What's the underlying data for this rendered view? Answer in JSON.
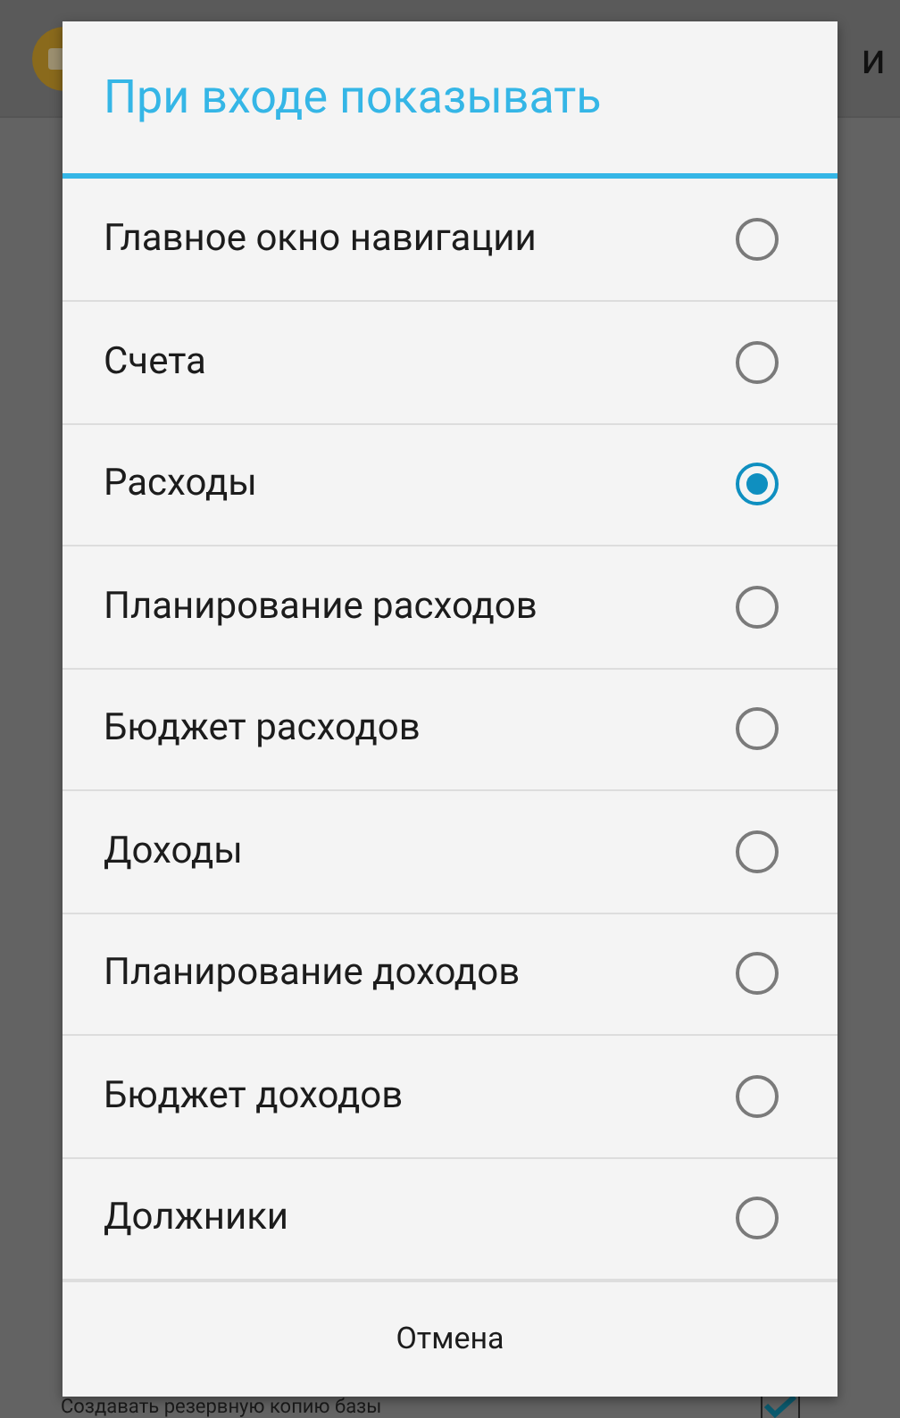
{
  "background": {
    "app_bar": {
      "title": "и"
    },
    "setting": {
      "label": "Создавать резервную копию базы",
      "checked": true
    }
  },
  "dialog": {
    "title": "При входе показывать",
    "options": [
      {
        "label": "Главное окно навигации",
        "selected": false
      },
      {
        "label": "Счета",
        "selected": false
      },
      {
        "label": "Расходы",
        "selected": true
      },
      {
        "label": "Планирование расходов",
        "selected": false
      },
      {
        "label": "Бюджет расходов",
        "selected": false
      },
      {
        "label": "Доходы",
        "selected": false
      },
      {
        "label": "Планирование доходов",
        "selected": false
      },
      {
        "label": "Бюджет доходов",
        "selected": false
      },
      {
        "label": "Должники",
        "selected": false
      }
    ],
    "buttons": [
      "Отмена"
    ]
  }
}
